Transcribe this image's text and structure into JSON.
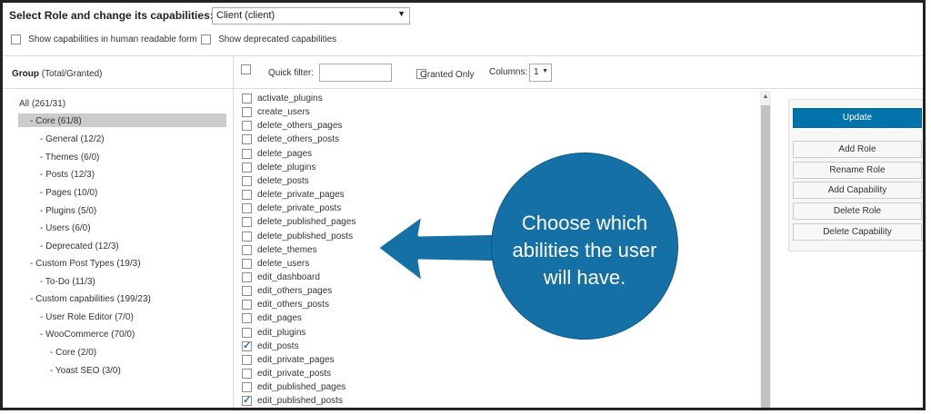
{
  "header": {
    "role_label": "Select Role and change its capabilities:",
    "role_value": "Client (client)",
    "option_human_readable": "Show capabilities in human readable form",
    "option_deprecated": "Show deprecated capabilities"
  },
  "groups": {
    "header_bold": "Group",
    "header_rest": " (Total/Granted)",
    "items": [
      "All (261/31)",
      "- Core (61/8)",
      "- General (12/2)",
      "- Themes (6/0)",
      "- Posts (12/3)",
      "- Pages (10/0)",
      "- Plugins (5/0)",
      "- Users (6/0)",
      "- Deprecated (12/3)",
      "- Custom Post Types (19/3)",
      "- To-Do (11/3)",
      "- Custom capabilities (199/23)",
      "- User Role Editor (7/0)",
      "- WooCommerce (70/0)",
      "- Core (2/0)",
      "- Yoast SEO (3/0)"
    ]
  },
  "filter_bar": {
    "quick_filter_label": "Quick filter:",
    "quick_filter_value": "",
    "granted_only_label": "Granted Only",
    "columns_label": "Columns:",
    "columns_value": "1"
  },
  "capabilities": [
    {
      "name": "activate_plugins",
      "checked": false
    },
    {
      "name": "create_users",
      "checked": false
    },
    {
      "name": "delete_others_pages",
      "checked": false
    },
    {
      "name": "delete_others_posts",
      "checked": false
    },
    {
      "name": "delete_pages",
      "checked": false
    },
    {
      "name": "delete_plugins",
      "checked": false
    },
    {
      "name": "delete_posts",
      "checked": false
    },
    {
      "name": "delete_private_pages",
      "checked": false
    },
    {
      "name": "delete_private_posts",
      "checked": false
    },
    {
      "name": "delete_published_pages",
      "checked": false
    },
    {
      "name": "delete_published_posts",
      "checked": false
    },
    {
      "name": "delete_themes",
      "checked": false
    },
    {
      "name": "delete_users",
      "checked": false
    },
    {
      "name": "edit_dashboard",
      "checked": false
    },
    {
      "name": "edit_others_pages",
      "checked": false
    },
    {
      "name": "edit_others_posts",
      "checked": false
    },
    {
      "name": "edit_pages",
      "checked": false
    },
    {
      "name": "edit_plugins",
      "checked": false
    },
    {
      "name": "edit_posts",
      "checked": true
    },
    {
      "name": "edit_private_pages",
      "checked": false
    },
    {
      "name": "edit_private_posts",
      "checked": false
    },
    {
      "name": "edit_published_pages",
      "checked": false
    },
    {
      "name": "edit_published_posts",
      "checked": true
    }
  ],
  "actions": {
    "update": "Update",
    "add_role": "Add Role",
    "rename_role": "Rename Role",
    "add_capability": "Add Capability",
    "delete_role": "Delete Role",
    "delete_capability": "Delete Capability"
  },
  "callout": {
    "text": "Choose which abilities the user will have.",
    "color": "#1570a6"
  },
  "colors": {
    "accent": "#0073aa",
    "selection": "#cccccc"
  }
}
